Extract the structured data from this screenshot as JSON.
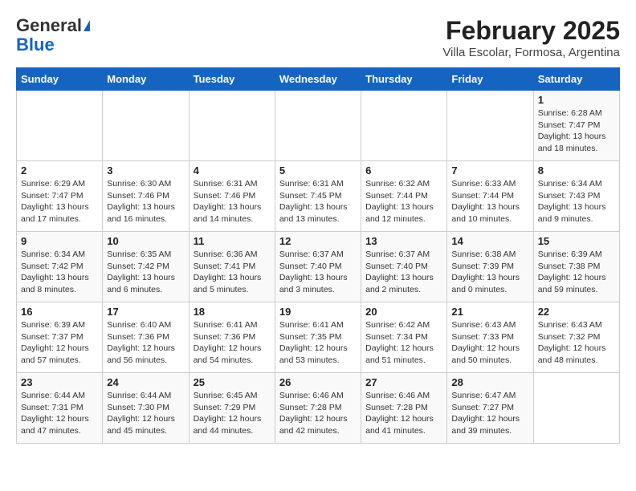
{
  "logo": {
    "general": "General",
    "blue": "Blue"
  },
  "title": "February 2025",
  "subtitle": "Villa Escolar, Formosa, Argentina",
  "days_of_week": [
    "Sunday",
    "Monday",
    "Tuesday",
    "Wednesday",
    "Thursday",
    "Friday",
    "Saturday"
  ],
  "weeks": [
    [
      {
        "day": "",
        "info": ""
      },
      {
        "day": "",
        "info": ""
      },
      {
        "day": "",
        "info": ""
      },
      {
        "day": "",
        "info": ""
      },
      {
        "day": "",
        "info": ""
      },
      {
        "day": "",
        "info": ""
      },
      {
        "day": "1",
        "info": "Sunrise: 6:28 AM\nSunset: 7:47 PM\nDaylight: 13 hours\nand 18 minutes."
      }
    ],
    [
      {
        "day": "2",
        "info": "Sunrise: 6:29 AM\nSunset: 7:47 PM\nDaylight: 13 hours\nand 17 minutes."
      },
      {
        "day": "3",
        "info": "Sunrise: 6:30 AM\nSunset: 7:46 PM\nDaylight: 13 hours\nand 16 minutes."
      },
      {
        "day": "4",
        "info": "Sunrise: 6:31 AM\nSunset: 7:46 PM\nDaylight: 13 hours\nand 14 minutes."
      },
      {
        "day": "5",
        "info": "Sunrise: 6:31 AM\nSunset: 7:45 PM\nDaylight: 13 hours\nand 13 minutes."
      },
      {
        "day": "6",
        "info": "Sunrise: 6:32 AM\nSunset: 7:44 PM\nDaylight: 13 hours\nand 12 minutes."
      },
      {
        "day": "7",
        "info": "Sunrise: 6:33 AM\nSunset: 7:44 PM\nDaylight: 13 hours\nand 10 minutes."
      },
      {
        "day": "8",
        "info": "Sunrise: 6:34 AM\nSunset: 7:43 PM\nDaylight: 13 hours\nand 9 minutes."
      }
    ],
    [
      {
        "day": "9",
        "info": "Sunrise: 6:34 AM\nSunset: 7:42 PM\nDaylight: 13 hours\nand 8 minutes."
      },
      {
        "day": "10",
        "info": "Sunrise: 6:35 AM\nSunset: 7:42 PM\nDaylight: 13 hours\nand 6 minutes."
      },
      {
        "day": "11",
        "info": "Sunrise: 6:36 AM\nSunset: 7:41 PM\nDaylight: 13 hours\nand 5 minutes."
      },
      {
        "day": "12",
        "info": "Sunrise: 6:37 AM\nSunset: 7:40 PM\nDaylight: 13 hours\nand 3 minutes."
      },
      {
        "day": "13",
        "info": "Sunrise: 6:37 AM\nSunset: 7:40 PM\nDaylight: 13 hours\nand 2 minutes."
      },
      {
        "day": "14",
        "info": "Sunrise: 6:38 AM\nSunset: 7:39 PM\nDaylight: 13 hours\nand 0 minutes."
      },
      {
        "day": "15",
        "info": "Sunrise: 6:39 AM\nSunset: 7:38 PM\nDaylight: 12 hours\nand 59 minutes."
      }
    ],
    [
      {
        "day": "16",
        "info": "Sunrise: 6:39 AM\nSunset: 7:37 PM\nDaylight: 12 hours\nand 57 minutes."
      },
      {
        "day": "17",
        "info": "Sunrise: 6:40 AM\nSunset: 7:36 PM\nDaylight: 12 hours\nand 56 minutes."
      },
      {
        "day": "18",
        "info": "Sunrise: 6:41 AM\nSunset: 7:36 PM\nDaylight: 12 hours\nand 54 minutes."
      },
      {
        "day": "19",
        "info": "Sunrise: 6:41 AM\nSunset: 7:35 PM\nDaylight: 12 hours\nand 53 minutes."
      },
      {
        "day": "20",
        "info": "Sunrise: 6:42 AM\nSunset: 7:34 PM\nDaylight: 12 hours\nand 51 minutes."
      },
      {
        "day": "21",
        "info": "Sunrise: 6:43 AM\nSunset: 7:33 PM\nDaylight: 12 hours\nand 50 minutes."
      },
      {
        "day": "22",
        "info": "Sunrise: 6:43 AM\nSunset: 7:32 PM\nDaylight: 12 hours\nand 48 minutes."
      }
    ],
    [
      {
        "day": "23",
        "info": "Sunrise: 6:44 AM\nSunset: 7:31 PM\nDaylight: 12 hours\nand 47 minutes."
      },
      {
        "day": "24",
        "info": "Sunrise: 6:44 AM\nSunset: 7:30 PM\nDaylight: 12 hours\nand 45 minutes."
      },
      {
        "day": "25",
        "info": "Sunrise: 6:45 AM\nSunset: 7:29 PM\nDaylight: 12 hours\nand 44 minutes."
      },
      {
        "day": "26",
        "info": "Sunrise: 6:46 AM\nSunset: 7:28 PM\nDaylight: 12 hours\nand 42 minutes."
      },
      {
        "day": "27",
        "info": "Sunrise: 6:46 AM\nSunset: 7:28 PM\nDaylight: 12 hours\nand 41 minutes."
      },
      {
        "day": "28",
        "info": "Sunrise: 6:47 AM\nSunset: 7:27 PM\nDaylight: 12 hours\nand 39 minutes."
      },
      {
        "day": "",
        "info": ""
      }
    ]
  ]
}
